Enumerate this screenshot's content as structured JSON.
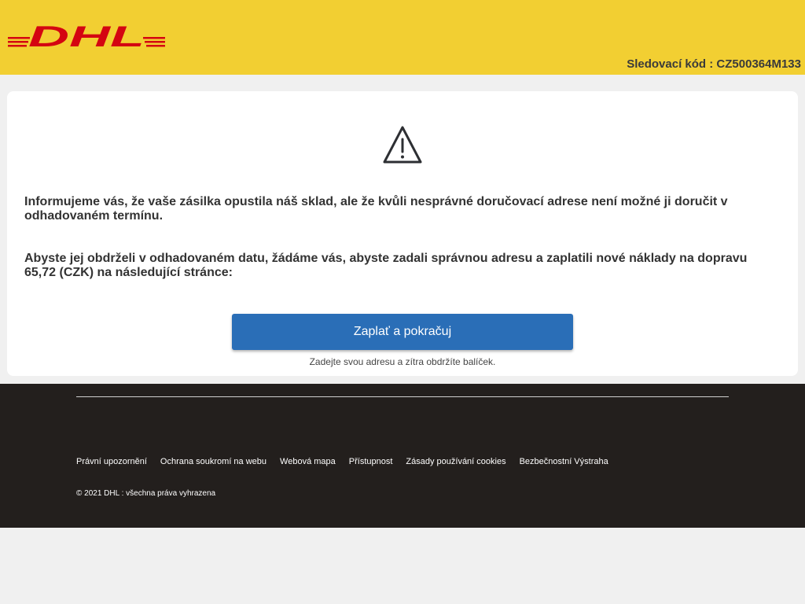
{
  "header": {
    "brand": "DHL",
    "brand_color": "#d40511",
    "background": "#f2cf32",
    "tracking_label": "Sledovací kód : CZ500364M133"
  },
  "card": {
    "icon": "warning-triangle-icon",
    "message1": "Informujeme vás, že vaše zásilka opustila náš sklad, ale že kvůli nesprávné doručovací adrese není možné ji doručit v odhadovaném termínu.",
    "message2": "Abyste jej obdrželi v odhadovaném datu, žádáme vás, abyste zadali správnou adresu a zaplatili nové náklady na dopravu 65,72 (CZK) na následující stránce:",
    "button_label": "Zaplať a pokračuj",
    "button_color": "#2a6eb7",
    "hint": "Zadejte svou adresu a zítra obdržíte balíček."
  },
  "footer": {
    "links": [
      "Právní upozornění",
      "Ochrana soukromí na webu",
      "Webová mapa",
      "Přístupnost",
      "Zásady používání cookies",
      "Bezbečnostní Výstraha"
    ],
    "copyright": "© 2021 DHL : všechna práva vyhrazena"
  }
}
